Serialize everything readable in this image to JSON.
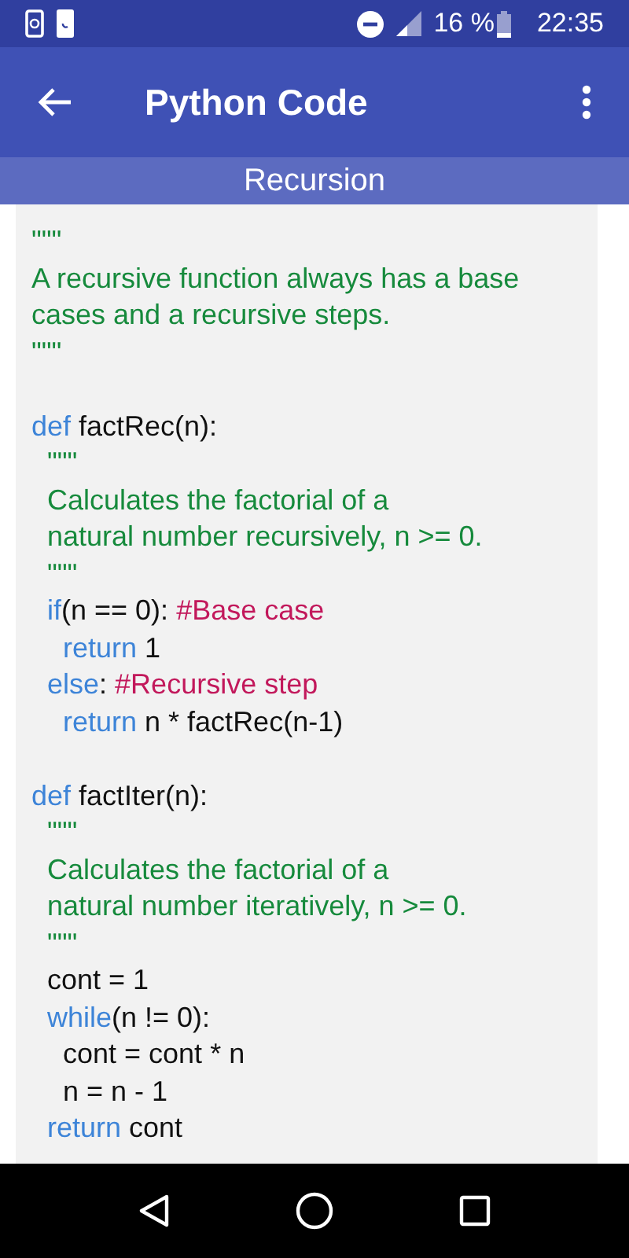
{
  "status_bar": {
    "battery": "16 %",
    "time": "22:35"
  },
  "app_bar": {
    "title": "Python Code"
  },
  "section": {
    "title": "Recursion"
  },
  "code": [
    {
      "tokens": [
        {
          "kind": "string",
          "text": "\"\"\""
        }
      ]
    },
    {
      "tokens": [
        {
          "kind": "string",
          "text": "A recursive function always has a base"
        }
      ]
    },
    {
      "tokens": [
        {
          "kind": "string",
          "text": "cases and a recursive steps."
        }
      ]
    },
    {
      "tokens": [
        {
          "kind": "string",
          "text": "\"\"\""
        }
      ]
    },
    {
      "kind": "blank"
    },
    {
      "tokens": [
        {
          "kind": "keyword",
          "text": "def"
        },
        {
          "kind": "plain",
          "text": " factRec(n):"
        }
      ]
    },
    {
      "tokens": [
        {
          "kind": "string",
          "text": "  \"\"\""
        }
      ]
    },
    {
      "tokens": [
        {
          "kind": "string",
          "text": "  Calculates the factorial of a"
        }
      ]
    },
    {
      "tokens": [
        {
          "kind": "string",
          "text": "  natural number recursively, n >= 0."
        }
      ]
    },
    {
      "tokens": [
        {
          "kind": "string",
          "text": "  \"\"\""
        }
      ]
    },
    {
      "tokens": [
        {
          "kind": "keyword",
          "text": "  if"
        },
        {
          "kind": "plain",
          "text": "(n == 0): "
        },
        {
          "kind": "comment",
          "text": "#Base case"
        }
      ]
    },
    {
      "tokens": [
        {
          "kind": "keyword",
          "text": "    return"
        },
        {
          "kind": "plain",
          "text": " 1"
        }
      ]
    },
    {
      "tokens": [
        {
          "kind": "keyword",
          "text": "  else"
        },
        {
          "kind": "plain",
          "text": ": "
        },
        {
          "kind": "comment",
          "text": "#Recursive step"
        }
      ]
    },
    {
      "tokens": [
        {
          "kind": "keyword",
          "text": "    return"
        },
        {
          "kind": "plain",
          "text": " n * factRec(n-1)"
        }
      ]
    },
    {
      "kind": "blank"
    },
    {
      "tokens": [
        {
          "kind": "keyword",
          "text": "def"
        },
        {
          "kind": "plain",
          "text": " factIter(n):"
        }
      ]
    },
    {
      "tokens": [
        {
          "kind": "string",
          "text": "  \"\"\""
        }
      ]
    },
    {
      "tokens": [
        {
          "kind": "string",
          "text": "  Calculates the factorial of a"
        }
      ]
    },
    {
      "tokens": [
        {
          "kind": "string",
          "text": "  natural number iteratively, n >= 0."
        }
      ]
    },
    {
      "tokens": [
        {
          "kind": "string",
          "text": "  \"\"\""
        }
      ]
    },
    {
      "tokens": [
        {
          "kind": "plain",
          "text": "  cont = 1"
        }
      ]
    },
    {
      "tokens": [
        {
          "kind": "keyword",
          "text": "  while"
        },
        {
          "kind": "plain",
          "text": "(n != 0):"
        }
      ]
    },
    {
      "tokens": [
        {
          "kind": "plain",
          "text": "    cont = cont * n"
        }
      ]
    },
    {
      "tokens": [
        {
          "kind": "plain",
          "text": "    n = n - 1"
        }
      ]
    },
    {
      "tokens": [
        {
          "kind": "keyword",
          "text": "  return"
        },
        {
          "kind": "plain",
          "text": " cont"
        }
      ]
    }
  ]
}
